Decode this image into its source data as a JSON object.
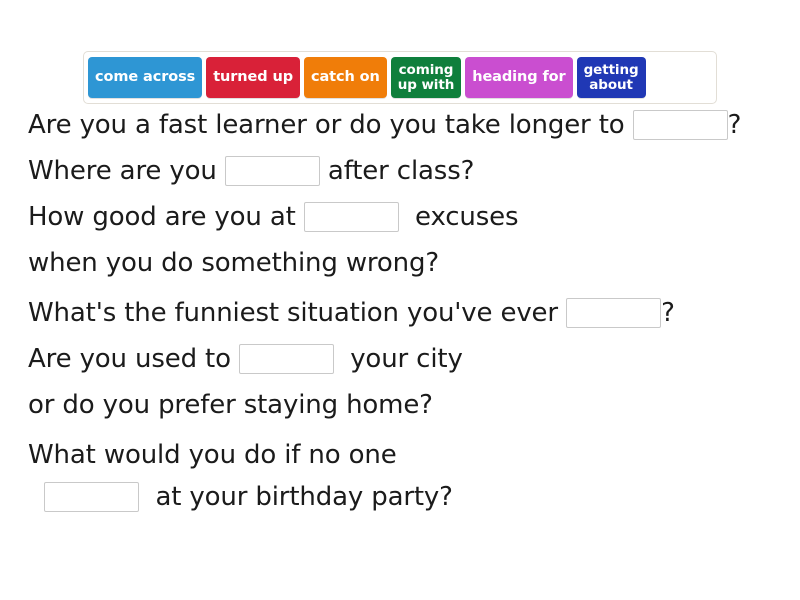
{
  "page": {
    "background_color": "#ffffff",
    "text_color": "#1b1b1b"
  },
  "word_bank": {
    "name": "phrasal-verb-word-bank",
    "border_color": "#e2ded6",
    "chips": [
      {
        "label": "come across",
        "color": "#2e96d4",
        "lines": 1
      },
      {
        "label": "turned up",
        "color": "#d92138",
        "lines": 1
      },
      {
        "label": "catch on",
        "color": "#f07d09",
        "lines": 1
      },
      {
        "label": "coming\nup with",
        "color": "#0f7f3c",
        "lines": 2
      },
      {
        "label": "heading for",
        "color": "#ca4ed0",
        "lines": 1
      },
      {
        "label": "getting\nabout",
        "color": "#2038b5",
        "lines": 2
      }
    ]
  },
  "blank": {
    "placeholder": "",
    "value": "",
    "border_color": "#c9c9c9"
  },
  "questions": [
    {
      "id": "q1",
      "lines": [
        {
          "parts": [
            {
              "type": "text",
              "value": "Are you a fast learner or do you take longer to "
            },
            {
              "type": "blank",
              "name": "answer-blank-1",
              "value": ""
            },
            {
              "type": "text",
              "value": "?"
            }
          ]
        }
      ]
    },
    {
      "id": "q2",
      "lines": [
        {
          "parts": [
            {
              "type": "text",
              "value": "Where are you "
            },
            {
              "type": "blank",
              "name": "answer-blank-2",
              "value": ""
            },
            {
              "type": "text",
              "value": " after class?"
            }
          ]
        }
      ]
    },
    {
      "id": "q3",
      "lines": [
        {
          "parts": [
            {
              "type": "text",
              "value": "How good are you at "
            },
            {
              "type": "blank",
              "name": "answer-blank-3",
              "value": ""
            },
            {
              "type": "text",
              "value": "  excuses"
            }
          ]
        },
        {
          "parts": [
            {
              "type": "text",
              "value": "when you do something wrong?"
            }
          ]
        }
      ]
    },
    {
      "id": "q4",
      "lines": [
        {
          "parts": [
            {
              "type": "text",
              "value": "What's the funniest situation you've ever "
            },
            {
              "type": "blank",
              "name": "answer-blank-4",
              "value": ""
            },
            {
              "type": "text",
              "value": "?"
            }
          ]
        }
      ]
    },
    {
      "id": "q5",
      "lines": [
        {
          "parts": [
            {
              "type": "text",
              "value": "Are you used to "
            },
            {
              "type": "blank",
              "name": "answer-blank-5",
              "value": ""
            },
            {
              "type": "text",
              "value": "  your city"
            }
          ]
        },
        {
          "parts": [
            {
              "type": "text",
              "value": "or do you prefer staying home?"
            }
          ]
        }
      ]
    },
    {
      "id": "q6",
      "lines": [
        {
          "parts": [
            {
              "type": "text",
              "value": "What would you do if no one"
            }
          ]
        },
        {
          "parts": [
            {
              "type": "text",
              "value": "  "
            },
            {
              "type": "blank",
              "name": "answer-blank-6",
              "value": ""
            },
            {
              "type": "text",
              "value": "  at your birthday party?"
            }
          ]
        }
      ]
    }
  ]
}
